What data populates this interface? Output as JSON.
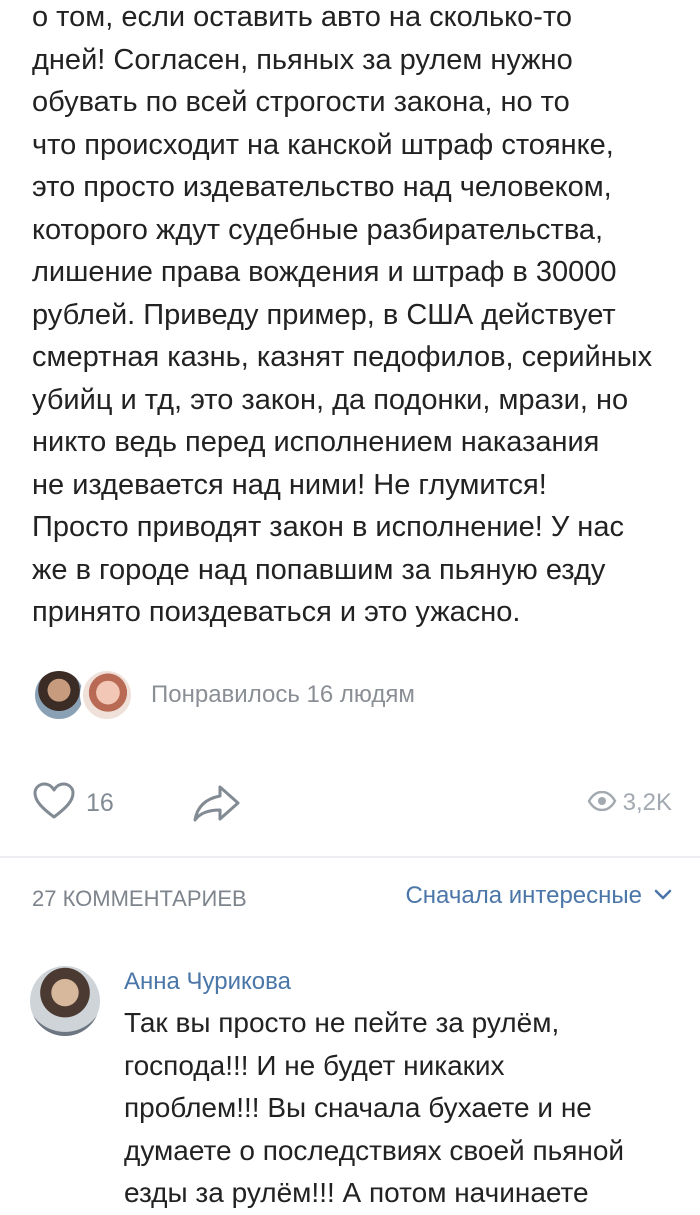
{
  "post": {
    "lines": [
      "о том, если оставить авто на сколько-то",
      "дней! Согласен, пьяных за рулем нужно",
      "обувать по всей строгости закона, но то",
      "что происходит на канской штраф стоянке,",
      "это просто издевательство над человеком,",
      "которого ждут судебные разбирательства,",
      "лишение права вождения и штраф в 30000",
      "рублей. Приведу пример, в США действует",
      "смертная казнь, казнят педофилов, серийных",
      "убийц и тд, это закон, да подонки, мрази, но",
      "никто ведь перед исполнением наказания",
      "не издевается над ними! Не глумится!",
      "Просто приводят закон в исполнение! У нас",
      "же в городе над попавшим за пьяную езду",
      "принято поиздеваться и это ужасно."
    ]
  },
  "likers": {
    "label": "Понравилось 16 людям"
  },
  "actions": {
    "like_count": "16",
    "views_count": "3,2K",
    "like_icon": "heart-icon",
    "share_icon": "share-arrow-icon",
    "views_icon": "eye-icon"
  },
  "comments": {
    "count_label": "27 КОММЕНТАРИЕВ",
    "sort_label": "Сначала интересные",
    "items": [
      {
        "author": "Анна Чурикова",
        "lines": [
          "Так вы просто не пейте за рулём,",
          "господа!!! И не будет никаких",
          "проблем!!! Вы сначала бухаете и не",
          "думаете о последствиях своей пьяной",
          "езды за рулём!!! А потом начинаете"
        ]
      }
    ]
  },
  "colors": {
    "text": "#222222",
    "accent": "#4a76a8",
    "muted": "#828a93",
    "separator": "#eceef1"
  }
}
